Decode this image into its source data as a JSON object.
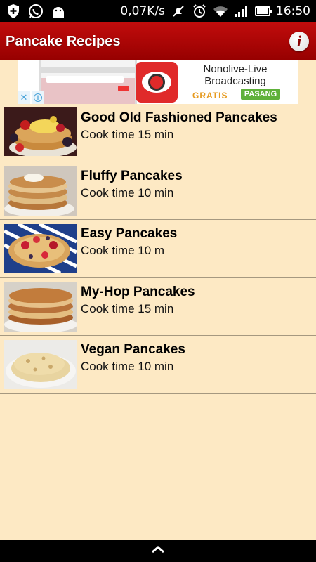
{
  "status_bar": {
    "network_speed": "0,07K/s",
    "time": "16:50",
    "left_icons": [
      "shield-plus-icon",
      "whatsapp-icon",
      "android-icon"
    ],
    "right_icons": [
      "mute-icon",
      "alarm-icon",
      "wifi-icon",
      "signal-icon",
      "battery-icon"
    ]
  },
  "app_bar": {
    "title": "Pancake Recipes",
    "info_label": "i"
  },
  "ad": {
    "title": "Nonolive-Live Broadcasting",
    "free_label": "GRATIS",
    "install_label": "PASANG",
    "close_label": "✕",
    "choices_label": "i"
  },
  "recipes": [
    {
      "name": "Good Old Fashioned Pancakes",
      "cook_time": "Cook time 15 min"
    },
    {
      "name": "Fluffy Pancakes",
      "cook_time": "Cook time 10 min"
    },
    {
      "name": "Easy Pancakes",
      "cook_time": "Cook time 10 m"
    },
    {
      "name": "My-Hop Pancakes",
      "cook_time": "Cook time 15 min"
    },
    {
      "name": "Vegan Pancakes",
      "cook_time": "Cook time 10 min"
    }
  ],
  "colors": {
    "app_bar": "#b00000",
    "list_background": "#fde9c4",
    "divider": "#a59880"
  }
}
